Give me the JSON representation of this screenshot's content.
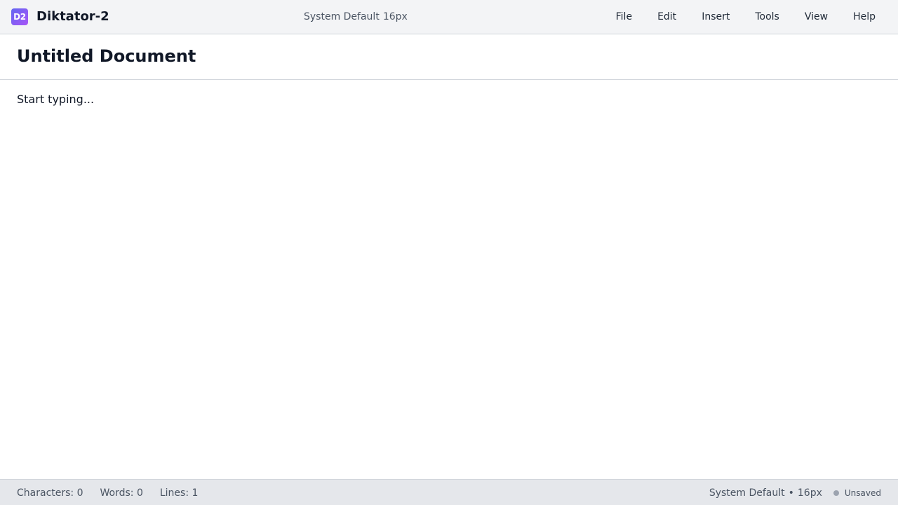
{
  "app": {
    "logo_text": "D2",
    "title": "Diktator-2"
  },
  "font_indicator": {
    "family": "System Default",
    "size": "16px"
  },
  "menu": {
    "items": [
      {
        "label": "File"
      },
      {
        "label": "Edit"
      },
      {
        "label": "Insert"
      },
      {
        "label": "Tools"
      },
      {
        "label": "View"
      },
      {
        "label": "Help"
      }
    ]
  },
  "document": {
    "title": "Untitled Document",
    "placeholder": "Start typing..."
  },
  "status": {
    "characters": "Characters: 0",
    "words": "Words: 0",
    "lines": "Lines: 1",
    "font_family": "System Default",
    "separator": "•",
    "font_size": "16px",
    "save_state": "Unsaved",
    "save_dot_color": "#9ca3af"
  },
  "colors": {
    "logo_gradient_start": "#6366f1",
    "logo_gradient_end": "#a855f7",
    "topbar_bg": "#f3f4f6",
    "statusbar_bg": "#e5e7eb"
  }
}
